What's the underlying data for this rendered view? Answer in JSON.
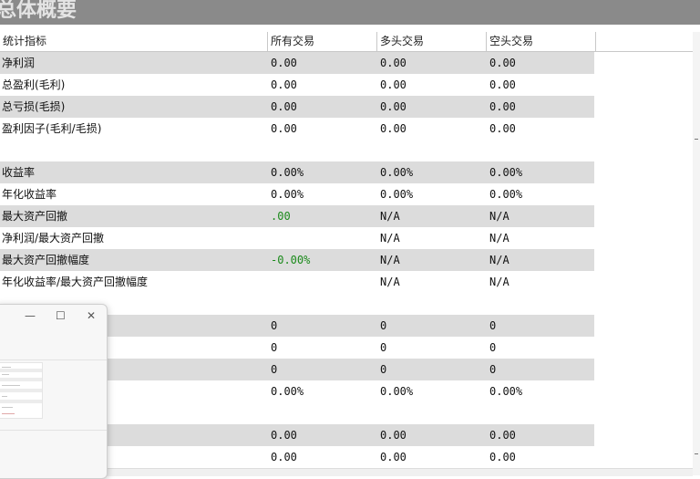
{
  "title": "总体概要",
  "columns": [
    "统计指标",
    "所有交易",
    "多头交易",
    "空头交易"
  ],
  "rows": [
    {
      "label": "净利润",
      "all": "0.00",
      "long": "0.00",
      "short": "0.00",
      "shaded": true
    },
    {
      "label": "总盈利(毛利)",
      "all": "0.00",
      "long": "0.00",
      "short": "0.00",
      "shaded": false
    },
    {
      "label": "总亏损(毛损)",
      "all": "0.00",
      "long": "0.00",
      "short": "0.00",
      "shaded": true
    },
    {
      "label": "盈利因子(毛利/毛损)",
      "all": "0.00",
      "long": "0.00",
      "short": "0.00",
      "shaded": false
    },
    {
      "label": "",
      "all": "",
      "long": "",
      "short": "",
      "shaded": false
    },
    {
      "label": "收益率",
      "all": "0.00%",
      "long": "0.00%",
      "short": "0.00%",
      "shaded": true
    },
    {
      "label": "年化收益率",
      "all": "0.00%",
      "long": "0.00%",
      "short": "0.00%",
      "shaded": false
    },
    {
      "label": "最大资产回撤",
      "all": ".00",
      "long": "N/A",
      "short": "N/A",
      "shaded": true,
      "all_color": "green"
    },
    {
      "label": "净利润/最大资产回撤",
      "all": "",
      "long": "N/A",
      "short": "N/A",
      "shaded": false
    },
    {
      "label": "最大资产回撤幅度",
      "all": "-0.00%",
      "long": "N/A",
      "short": "N/A",
      "shaded": true,
      "all_color": "green"
    },
    {
      "label": "年化收益率/最大资产回撤幅度",
      "all": "",
      "long": "N/A",
      "short": "N/A",
      "shaded": false
    },
    {
      "label": "",
      "all": "",
      "long": "",
      "short": "",
      "shaded": false
    },
    {
      "label": "",
      "all": "0",
      "long": "0",
      "short": "0",
      "shaded": true
    },
    {
      "label": "",
      "all": "0",
      "long": "0",
      "short": "0",
      "shaded": false
    },
    {
      "label": "",
      "all": "0",
      "long": "0",
      "short": "0",
      "shaded": true
    },
    {
      "label": "",
      "all": "0.00%",
      "long": "0.00%",
      "short": "0.00%",
      "shaded": false
    },
    {
      "label": "",
      "all": "",
      "long": "",
      "short": "",
      "shaded": false
    },
    {
      "label": "",
      "all": "0.00",
      "long": "0.00",
      "short": "0.00",
      "shaded": true
    },
    {
      "label": "",
      "all": "0.00",
      "long": "0.00",
      "short": "0.00",
      "shaded": false
    }
  ],
  "window_controls": {
    "minimize": "—",
    "maximize": "☐",
    "close": "✕"
  },
  "colors": {
    "header_bar": "#8a8a8a",
    "row_shade": "#dcdcdc",
    "positive_green": "#1a8a1a"
  }
}
